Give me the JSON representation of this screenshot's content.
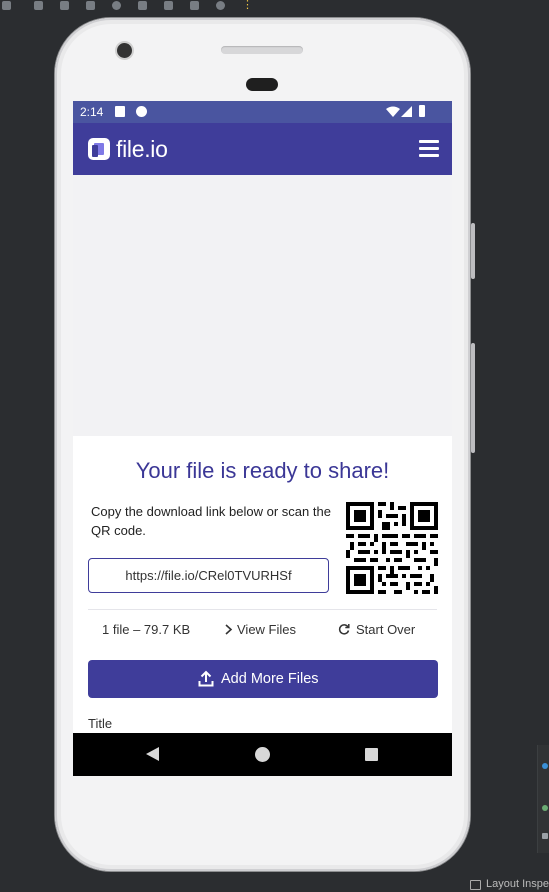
{
  "ide": {
    "bottom_label": "Layout Inspe"
  },
  "status_bar": {
    "time": "2:14"
  },
  "app_bar": {
    "logo_text": "file.io"
  },
  "share_card": {
    "headline": "Your file is ready to share!",
    "instructions": "Copy the download link below or scan the QR code.",
    "link": "https://file.io/CRel0TVURHSf",
    "file_info": "1 file – 79.7 KB",
    "view_files": "View Files",
    "start_over": "Start Over",
    "add_more": "Add More Files",
    "title_label": "Title"
  },
  "colors": {
    "brand": "#3f3d9a",
    "status_bar": "#4a55a0",
    "headline": "#3b3796"
  },
  "icons": [
    "menu-icon",
    "chevron-right-icon",
    "refresh-icon",
    "upload-icon",
    "qr-code-icon",
    "wifi-icon",
    "signal-icon",
    "battery-icon"
  ]
}
